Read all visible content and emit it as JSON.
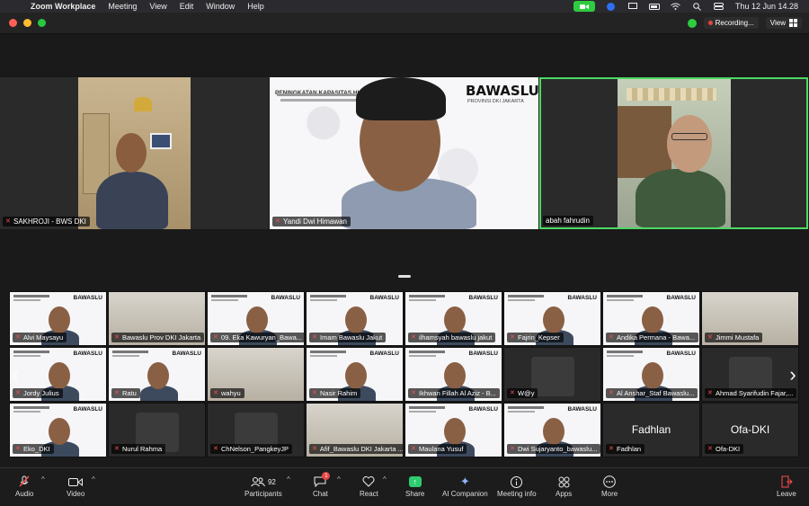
{
  "menubar": {
    "app_name": "Zoom Workplace",
    "items": [
      "Meeting",
      "View",
      "Edit",
      "Window",
      "Help"
    ],
    "datetime": "Thu 12 Jun  14.28"
  },
  "titlebar": {
    "recording_label": "Recording...",
    "view_label": "View"
  },
  "speakers": [
    {
      "name": "SAKHROJI - BWS DKI"
    },
    {
      "name": "Yandi Dwi Himawan",
      "slide_logo": "BAWASLU",
      "slide_title": "PENINGKATAN KAPASITAS HUKUM",
      "slide_sub": "PROVINSI DKI JAKARTA"
    },
    {
      "name": "abah fahrudin"
    }
  ],
  "gallery": [
    {
      "name": "Alvi Maysayu",
      "bg": "slide"
    },
    {
      "name": "Bawaslu Prov DKI Jakarta",
      "bg": "room"
    },
    {
      "name": "09. Eka Kawuryan_Bawa...",
      "bg": "slide"
    },
    {
      "name": "Imam Bawaslu Jakut",
      "bg": "slide"
    },
    {
      "name": "ilhamsyah bawaslu jakut",
      "bg": "slide"
    },
    {
      "name": "Fajrin_Kepser",
      "bg": "slide"
    },
    {
      "name": "Andika Permana - Bawa...",
      "bg": "slide"
    },
    {
      "name": "Jimmi Mustafa",
      "bg": "room"
    },
    {
      "name": "Jordy Julius",
      "bg": "slide"
    },
    {
      "name": "Ratu",
      "bg": "slide"
    },
    {
      "name": "wahyu",
      "bg": "room"
    },
    {
      "name": "Nasir Rahim",
      "bg": "slide"
    },
    {
      "name": "Ikhwan Fillah Al Aziz - B...",
      "bg": "slide"
    },
    {
      "name": "W@y",
      "bg": "dark"
    },
    {
      "name": "Al Anshar_Staf Bawaslu...",
      "bg": "slide"
    },
    {
      "name": "Ahmad Syarifudin Fajar,...",
      "bg": "dark"
    },
    {
      "name": "Eko_DKI",
      "bg": "slide"
    },
    {
      "name": "Nurul Rahma",
      "bg": "dark"
    },
    {
      "name": "ChNelson_PangkeyJP",
      "bg": "dark"
    },
    {
      "name": "Afif_Bawaslu DKI Jakarta ...",
      "bg": "room"
    },
    {
      "name": "Maulana Yusuf",
      "bg": "slide"
    },
    {
      "name": "Dwi Sujaryanto_bawaslu...",
      "bg": "slide"
    },
    {
      "name": "Fadhlan",
      "bg": "dark",
      "big": "Fadhlan"
    },
    {
      "name": "Ofa-DKI",
      "bg": "dark",
      "big": "Ofa-DKI"
    }
  ],
  "mini_logo": "BAWASLU",
  "toolbar": {
    "audio": "Audio",
    "video": "Video",
    "participants": "Participants",
    "participant_count": "92",
    "chat": "Chat",
    "chat_badge": "1",
    "react": "React",
    "share": "Share",
    "ai_companion": "AI Companion",
    "meeting_info": "Meeting info",
    "apps": "Apps",
    "more": "More",
    "leave": "Leave"
  }
}
